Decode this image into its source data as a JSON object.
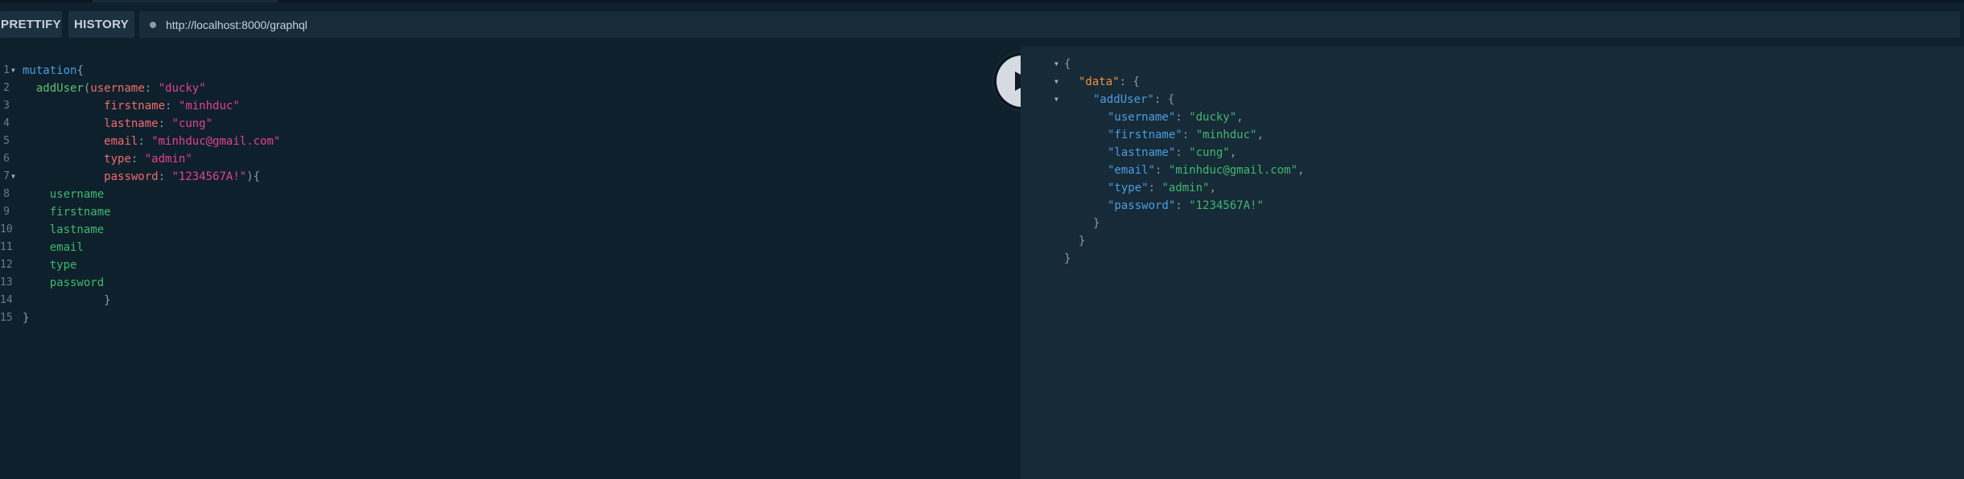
{
  "toolbar": {
    "prettify_label": "PRETTIFY",
    "history_label": "HISTORY",
    "url_value": "http://localhost:8000/graphql"
  },
  "editor": {
    "line_numbers": [
      "1",
      "2",
      "3",
      "4",
      "5",
      "6",
      "7",
      "8",
      "9",
      "10",
      "11",
      "12",
      "13",
      "14",
      "15"
    ],
    "tokens": {
      "l1_kw": "mutation",
      "l1_brace": "{",
      "l2_fn": "addUser",
      "l2_paren": "(",
      "arg_username": "username",
      "val_username": "\"ducky\"",
      "arg_firstname": "firstname",
      "val_firstname": "\"minhduc\"",
      "arg_lastname": "lastname",
      "val_lastname": "\"cung\"",
      "arg_email": "email",
      "val_email": "\"minhduc@gmail.com\"",
      "arg_type": "type",
      "val_type": "\"admin\"",
      "arg_password": "password",
      "val_password": "\"1234567A!\"",
      "l7_close": "){",
      "colon": ":",
      "f_username": "username",
      "f_firstname": "firstname",
      "f_lastname": "lastname",
      "f_email": "email",
      "f_type": "type",
      "f_password": "password",
      "close_brace": "}"
    }
  },
  "result": {
    "open": "{",
    "data_key": "\"data\"",
    "adduser_key": "\"addUser\"",
    "colon_brace": ": {",
    "rows": [
      {
        "key": "\"username\"",
        "value": "\"ducky\"",
        "sep": ","
      },
      {
        "key": "\"firstname\"",
        "value": "\"minhduc\"",
        "sep": ","
      },
      {
        "key": "\"lastname\"",
        "value": "\"cung\"",
        "sep": ","
      },
      {
        "key": "\"email\"",
        "value": "\"minhduc@gmail.com\"",
        "sep": ","
      },
      {
        "key": "\"type\"",
        "value": "\"admin\"",
        "sep": ","
      },
      {
        "key": "\"password\"",
        "value": "\"1234567A!\"",
        "sep": ""
      }
    ],
    "colon": ": ",
    "close": "}"
  },
  "icons": {
    "run": "play-icon",
    "fold": "triangle-down-icon"
  },
  "colors": {
    "background": "#0f202d",
    "result_background": "#172a38",
    "keyword": "#4a9ee0",
    "argument": "#f26b6b",
    "string": "#e0438a",
    "field": "#3fb96d"
  }
}
